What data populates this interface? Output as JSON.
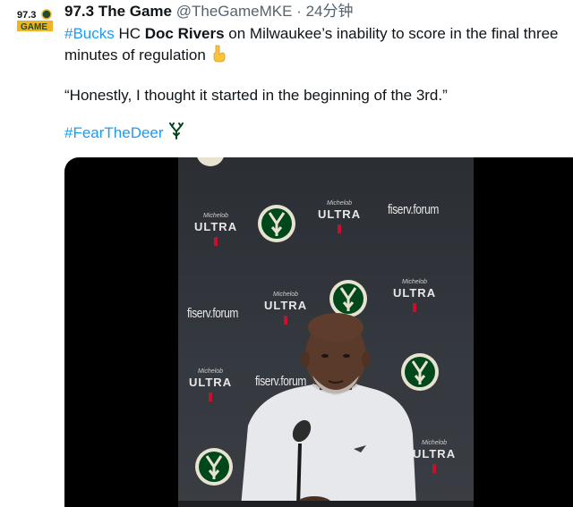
{
  "tweet": {
    "display_name": "97.3 The Game",
    "handle": "@TheGameMKE",
    "separator": "·",
    "time": "24分钟",
    "avatar": {
      "line1": "97.3",
      "line2": "GAME",
      "icon": "station-logo-icon"
    },
    "text": {
      "hashtag1": "#Bucks",
      "pre_bold": " HC ",
      "bold_name": "Doc Rivers",
      "line1_rest": " on Milwaukee’s inability to score in the final three minutes of regulation",
      "emoji1": "pointing-down-icon",
      "quote": "“Honestly, I thought it started in the beginning of the 3rd.”",
      "hashtag2": "#FearTheDeer",
      "emoji2": "deer-antlers-icon"
    }
  },
  "media": {
    "backdrop": {
      "ultra_script": "Michelob",
      "ultra_word": "ULTRA",
      "fiserv_word": "fiserv.forum",
      "logo_icon": "bucks-logo-icon"
    }
  }
}
